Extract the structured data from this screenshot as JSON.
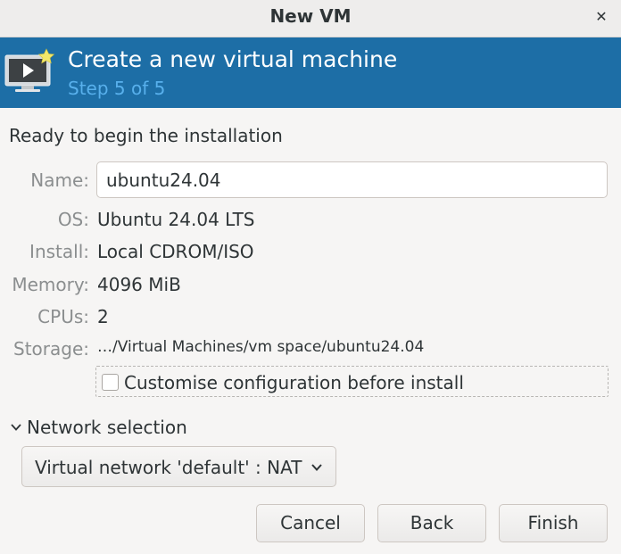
{
  "window": {
    "title": "New VM"
  },
  "header": {
    "title": "Create a new virtual machine",
    "step": "Step 5 of 5",
    "accent_color": "#1d6ea6",
    "step_color": "#58b0ec",
    "icon": "vm-monitor-icon"
  },
  "section_title": "Ready to begin the installation",
  "fields": {
    "name": {
      "label": "Name:",
      "value": "ubuntu24.04"
    },
    "os": {
      "label": "OS:",
      "value": "Ubuntu 24.04 LTS"
    },
    "install": {
      "label": "Install:",
      "value": "Local CDROM/ISO"
    },
    "memory": {
      "label": "Memory:",
      "value": "4096 MiB"
    },
    "cpus": {
      "label": "CPUs:",
      "value": "2"
    },
    "storage": {
      "label": "Storage:",
      "value": "…/Virtual Machines/vm space/ubuntu24.04"
    }
  },
  "customise": {
    "label": "Customise configuration before install",
    "checked": false
  },
  "network": {
    "expander_label": "Network selection",
    "selected": "Virtual network 'default' : NAT"
  },
  "buttons": {
    "cancel": "Cancel",
    "back": "Back",
    "finish": "Finish"
  }
}
